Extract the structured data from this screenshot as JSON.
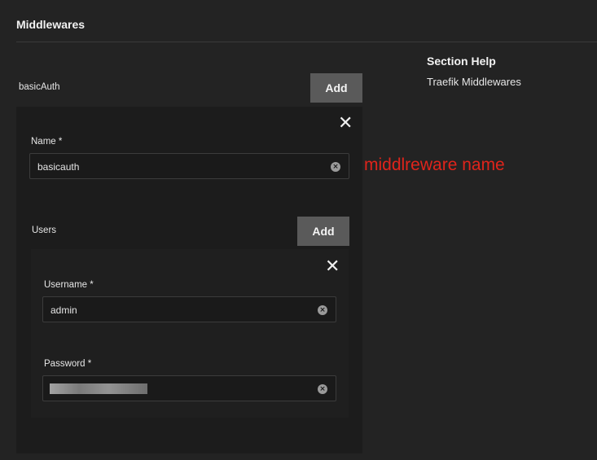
{
  "section": {
    "title": "Middlewares"
  },
  "help": {
    "title": "Section Help",
    "text": "Traefik Middlewares"
  },
  "basic_auth": {
    "label": "basicAuth",
    "add_label": "Add",
    "close_glyph": "✕",
    "name_field": {
      "label": "Name",
      "required_mark": "*",
      "value": "basicauth"
    },
    "users": {
      "label": "Users",
      "add_label": "Add",
      "close_glyph": "✕",
      "username_field": {
        "label": "Username",
        "required_mark": "*",
        "value": "admin"
      },
      "password_field": {
        "label": "Password",
        "required_mark": "*",
        "value_masked": true
      }
    }
  },
  "annotation": {
    "text": "middlreware name",
    "color": "#e0241b"
  },
  "icons": {
    "clear": "clear-circle-x-icon",
    "close": "close-icon"
  },
  "colors": {
    "background": "#232323",
    "button": "#5a5a5a",
    "panel": "#1c1c1c"
  }
}
